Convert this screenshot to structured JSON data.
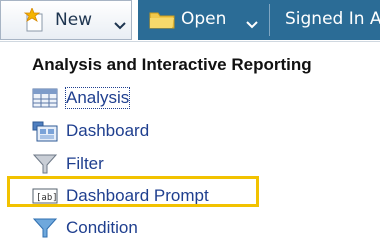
{
  "toolbar": {
    "new_label": "New",
    "new_icon": "new-document-icon",
    "open_label": "Open",
    "open_icon": "folder-icon",
    "signed_in_label": "Signed In A",
    "accent_color": "#2b6c96"
  },
  "menu": {
    "section_title": "Analysis and Interactive Reporting",
    "items": [
      {
        "label": "Analysis",
        "icon": "analysis-table-icon"
      },
      {
        "label": "Dashboard",
        "icon": "dashboard-icon"
      },
      {
        "label": "Filter",
        "icon": "filter-funnel-icon"
      },
      {
        "label": "Dashboard Prompt",
        "icon": "prompt-field-icon",
        "highlighted": true
      },
      {
        "label": "Condition",
        "icon": "condition-funnel-icon"
      }
    ],
    "highlight_color": "#f2c200"
  }
}
